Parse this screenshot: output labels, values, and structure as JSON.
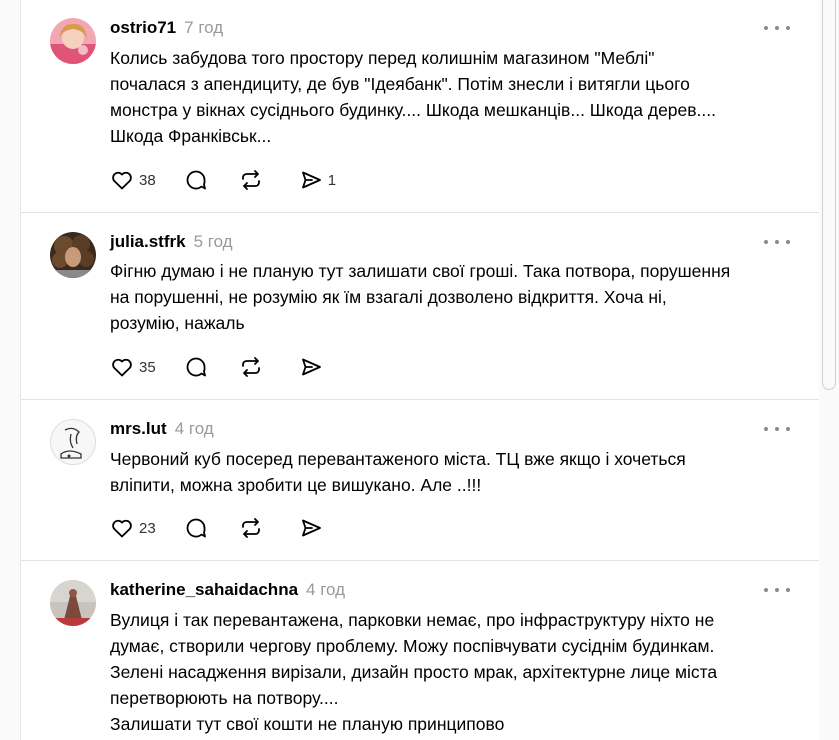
{
  "posts": [
    {
      "username": "ostrio71",
      "time": "7 год",
      "lines": [
        "Колись забудова того простору перед колишнім магазином \"Меблі\"",
        "почалася з апендициту, де був \"Ідеябанк\". Потім знесли і витягли цього",
        "монстра у вікнах сусіднього будинку.... Шкода мешканців... Шкода дерев....",
        "Шкода Франківськ..."
      ],
      "likes": "38",
      "reposts": "",
      "shares": "1"
    },
    {
      "username": "julia.stfrk",
      "time": "5 год",
      "lines": [
        "Фігню думаю і не планую тут залишати свої гроші. Така потвора, порушення",
        "на порушенні, не розумію як їм взагалі дозволено відкриття. Хоча ні,",
        "розумію, нажаль"
      ],
      "likes": "35",
      "reposts": "",
      "shares": ""
    },
    {
      "username": "mrs.lut",
      "time": "4 год",
      "lines": [
        "Червоний куб посеред перевантаженого міста. ТЦ вже якщо і хочеться",
        "вліпити, можна зробити це вишукано. Але ..!!!"
      ],
      "likes": "23",
      "reposts": "",
      "shares": ""
    },
    {
      "username": "katherine_sahaidachna",
      "time": "4 год",
      "lines": [
        "Вулиця і так перевантажена, парковки немає, про інфраструктуру ніхто не",
        "думає, створили чергову проблему. Можу поспівчувати сусіднім будинкам.",
        "Зелені насадження вирізали, дизайн просто мрак, архітектурне лице міста",
        "перетворюють на потвору....",
        "Залишати тут свої кошти не планую принципово"
      ],
      "likes": "",
      "reposts": "",
      "shares": ""
    }
  ]
}
